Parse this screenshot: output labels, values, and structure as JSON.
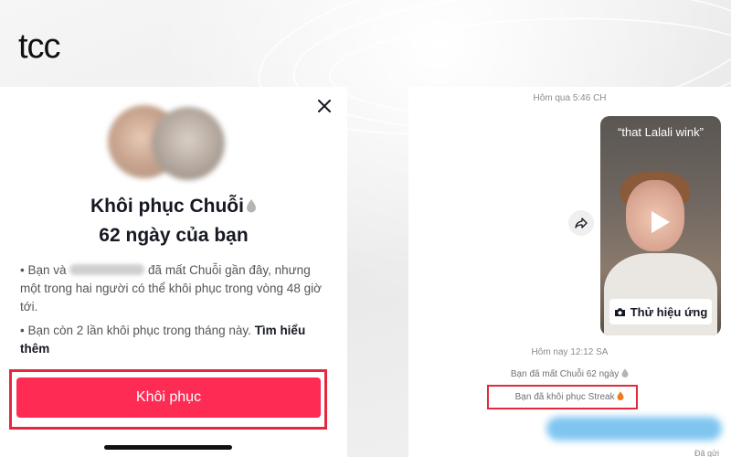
{
  "brand": {
    "logo_text": "tcc"
  },
  "restore_dialog": {
    "title_line1": "Khôi phục Chuỗi",
    "title_line2": "62 ngày của bạn",
    "bullet1_prefix": "Bạn và",
    "bullet1_suffix": "đã mất Chuỗi gần đây, nhưng một trong hai người có thể khôi phục trong vòng 48 giờ tới.",
    "bullet2_text": "Bạn còn 2 lần khôi phục trong tháng này.",
    "bullet2_link": "Tìm hiểu thêm",
    "restore_button": "Khôi phục"
  },
  "chat": {
    "timestamp_yesterday": "Hôm qua 5:46 CH",
    "video_caption": "“that Lalali wink”",
    "try_effect_button": "Thử hiệu ứng",
    "timestamp_today": "Hôm nay 12:12 SA",
    "streak_lost_msg": "Bạn đã mất Chuỗi 62 ngày",
    "streak_restored_msg": "Bạn đã khôi phục Streak",
    "sent_status": "Đã gửi"
  },
  "colors": {
    "accent": "#fe2c55",
    "highlight_box": "#e5283e",
    "flame_gray": "#b5b5b5",
    "flame_orange": "#f07a1c"
  },
  "icons": [
    "close-icon",
    "drop-icon",
    "share-icon",
    "play-icon",
    "camera-icon",
    "flame-icon"
  ]
}
